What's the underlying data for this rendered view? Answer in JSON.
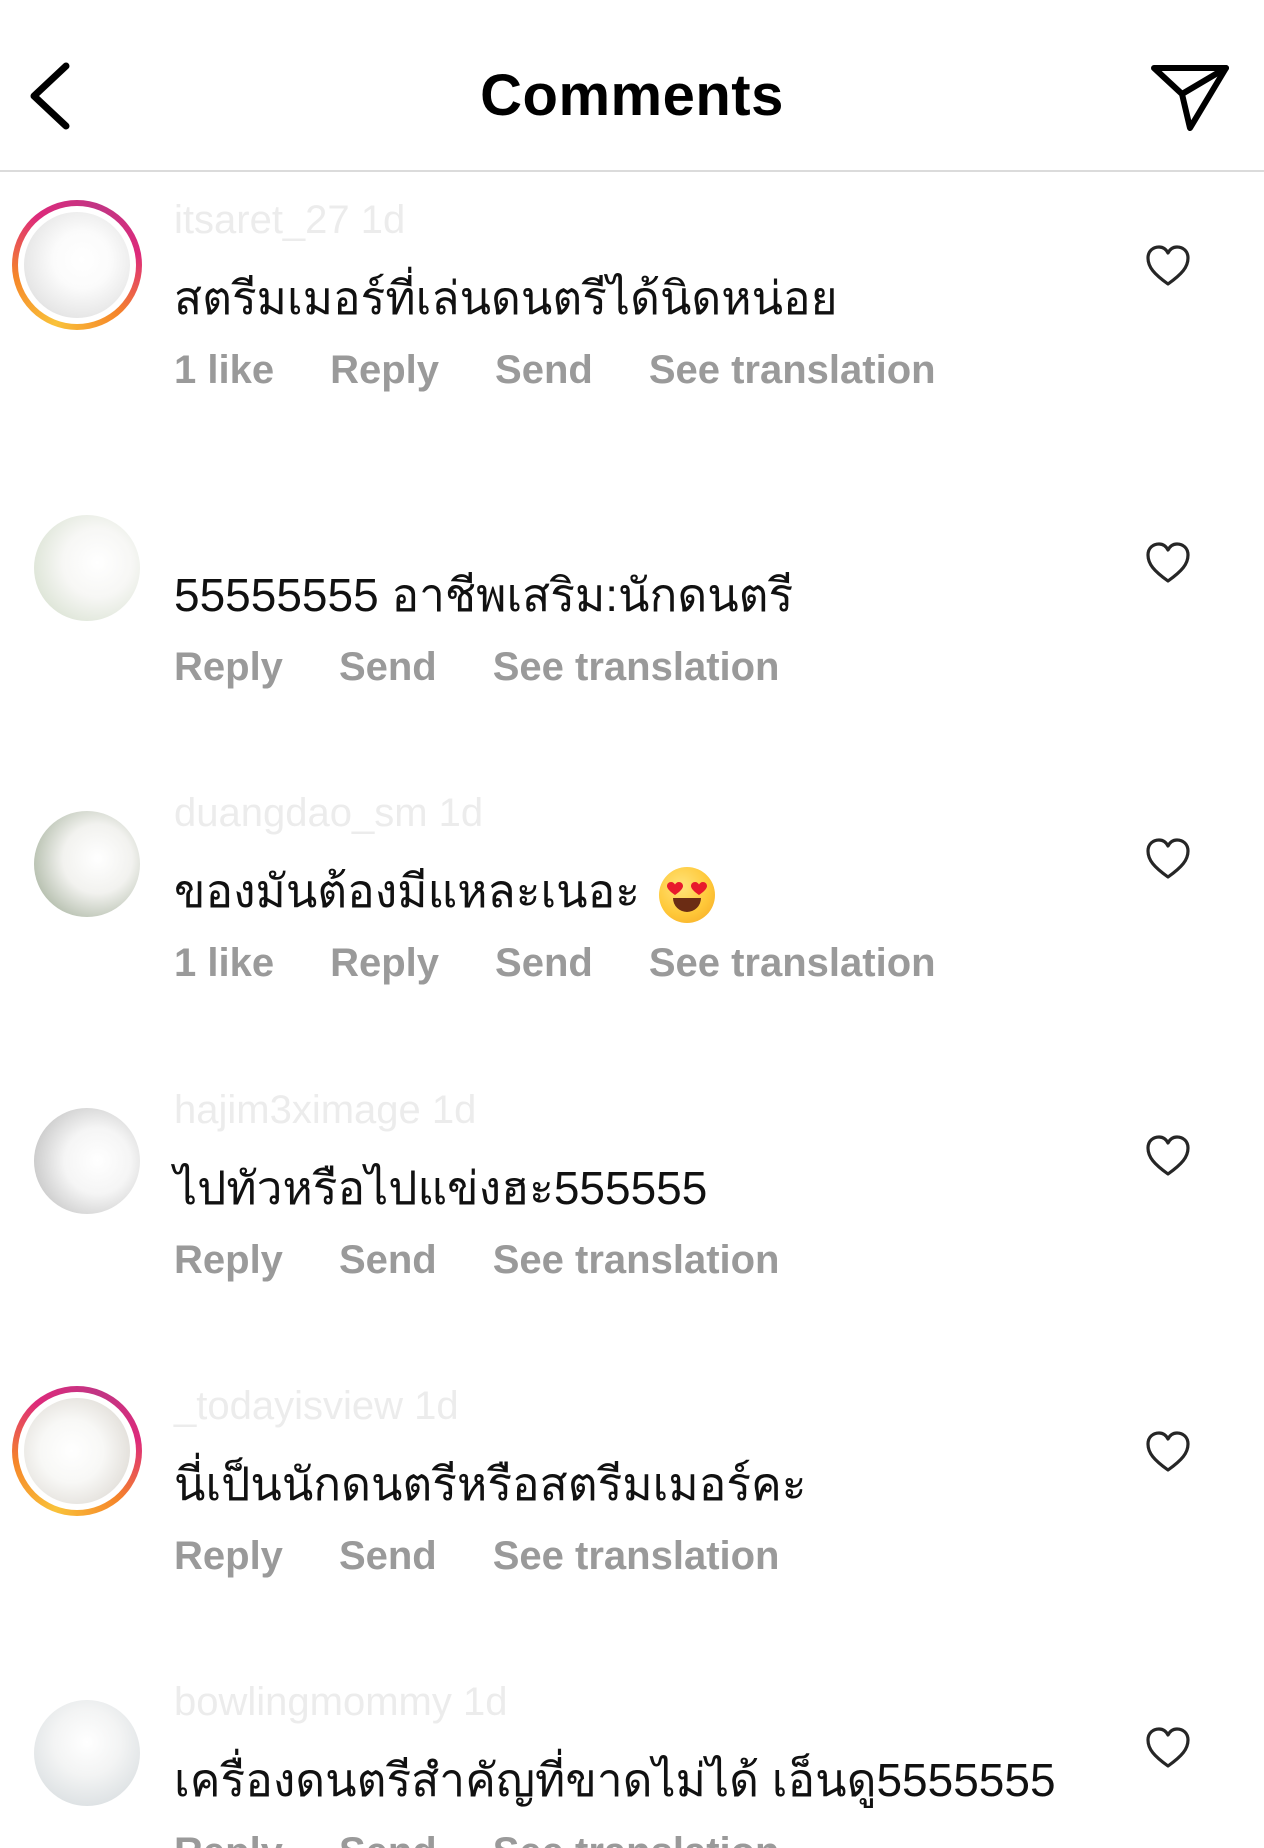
{
  "header": {
    "title": "Comments",
    "back_icon": "chevron-left-icon",
    "share_icon": "paper-plane-icon"
  },
  "comments": [
    {
      "username": "itsaret_27 1d",
      "text": "สตรีมเมอร์ที่เล่นดนตรีได้นิดหน่อย",
      "likes": "1 like",
      "reply": "Reply",
      "send": "Send",
      "translate": "See translation",
      "story_ring": true
    },
    {
      "username": "",
      "text": "55555555 อาชีพเสริม:นักดนตรี",
      "likes": "",
      "reply": "Reply",
      "send": "Send",
      "translate": "See translation",
      "story_ring": false
    },
    {
      "username": "duangdao_sm 1d",
      "text": "ของมันต้องมีแหละเนอะ",
      "likes": "1 like",
      "reply": "Reply",
      "send": "Send",
      "translate": "See translation",
      "story_ring": false,
      "emoji": "heart-eyes-emoji"
    },
    {
      "username": "hajim3ximage 1d",
      "text": "ไปทัวหรือไปแข่งฮะ555555",
      "likes": "",
      "reply": "Reply",
      "send": "Send",
      "translate": "See translation",
      "story_ring": false
    },
    {
      "username": "_todayisview 1d",
      "text": "นี่เป็นนักดนตรีหรือสตรีมเมอร์คะ",
      "likes": "",
      "reply": "Reply",
      "send": "Send",
      "translate": "See translation",
      "story_ring": true
    },
    {
      "username": "bowlingmommy 1d",
      "text": "เครื่องดนตรีสำคัญที่ขาดไม่ได้ เอ็นดู5555555",
      "likes": "",
      "reply": "Reply",
      "send": "Send",
      "translate": "See translation",
      "story_ring": false
    }
  ],
  "colors": {
    "action_gray": "#9a9a9a",
    "divider": "#dbdbdb",
    "username_faded": "#ececec"
  }
}
